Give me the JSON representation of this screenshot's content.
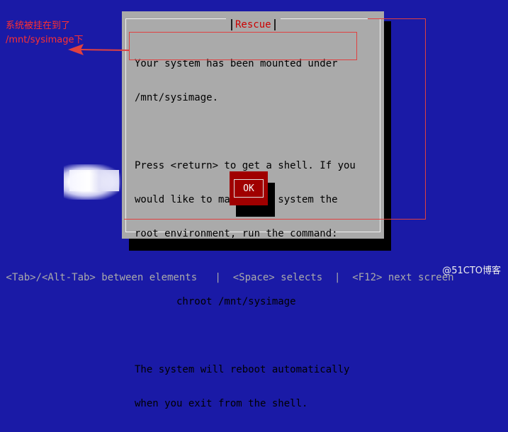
{
  "dialog": {
    "title": "Rescue",
    "lines": [
      "Your system has been mounted under",
      "/mnt/sysimage.",
      "",
      "Press <return> to get a shell. If you",
      "would like to make your system the",
      "root environment, run the command:",
      "",
      "       chroot /mnt/sysimage",
      "",
      "The system will reboot automatically",
      "when you exit from the shell."
    ],
    "ok_label": "OK"
  },
  "annotation": {
    "line1": "系统被挂在到了",
    "line2": "/mnt/sysimage下"
  },
  "statusbar": {
    "text": " <Tab>/<Alt-Tab> between elements   |  <Space> selects  |  <F12> next screen"
  },
  "watermark": "@51CTO博客",
  "colors": {
    "background": "#1a1aa6",
    "dialog": "#aaaaaa",
    "title": "#cc0000",
    "button": "#a00000",
    "annotation": "#e04040"
  }
}
